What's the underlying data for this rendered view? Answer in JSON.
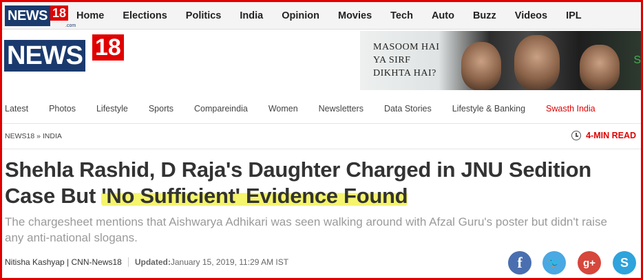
{
  "topnav": {
    "logo_text": "NEWS",
    "logo_num": "18",
    "logo_domain": ".com",
    "items": [
      "Home",
      "Elections",
      "Politics",
      "India",
      "Opinion",
      "Movies",
      "Tech",
      "Auto",
      "Buzz",
      "Videos",
      "IPL"
    ]
  },
  "header": {
    "logo_text": "NEWS",
    "logo_num": "18"
  },
  "promo": {
    "line1": "MASOOM HAI",
    "line2": "YA SIRF",
    "line3": "DIKHTA HAI?",
    "corner": "S"
  },
  "catnav": {
    "items": [
      "Latest",
      "Photos",
      "Lifestyle",
      "Sports",
      "Compareindia",
      "Women",
      "Newsletters",
      "Data Stories",
      "Lifestyle & Banking",
      "Swasth India"
    ],
    "highlight_color": "#e00000"
  },
  "breadcrumb": {
    "home": "NEWS18",
    "separator": " » ",
    "section": "INDIA"
  },
  "read_time": "4-MIN READ",
  "article": {
    "headline_part1": "Shehla Rashid, D Raja's Daughter Charged in JNU Sedition Case But ",
    "headline_highlight": "'No Sufficient' Evidence Found",
    "summary": "The chargesheet mentions that Aishwarya Adhikari was seen walking around with Afzal Guru's poster but didn't raise any anti-national slogans.",
    "author": "Nitisha Kashyap | CNN-News18",
    "updated_label": "Updated:",
    "updated_date": "January 15, 2019, 11:29 AM IST"
  },
  "social": {
    "facebook_glyph": "f",
    "twitter_glyph": "🐦",
    "gplus_glyph": "g+",
    "skype_glyph": "S"
  },
  "colors": {
    "brand_red": "#e00000",
    "brand_blue": "#1a3a6e",
    "highlight": "#f0f03c"
  }
}
